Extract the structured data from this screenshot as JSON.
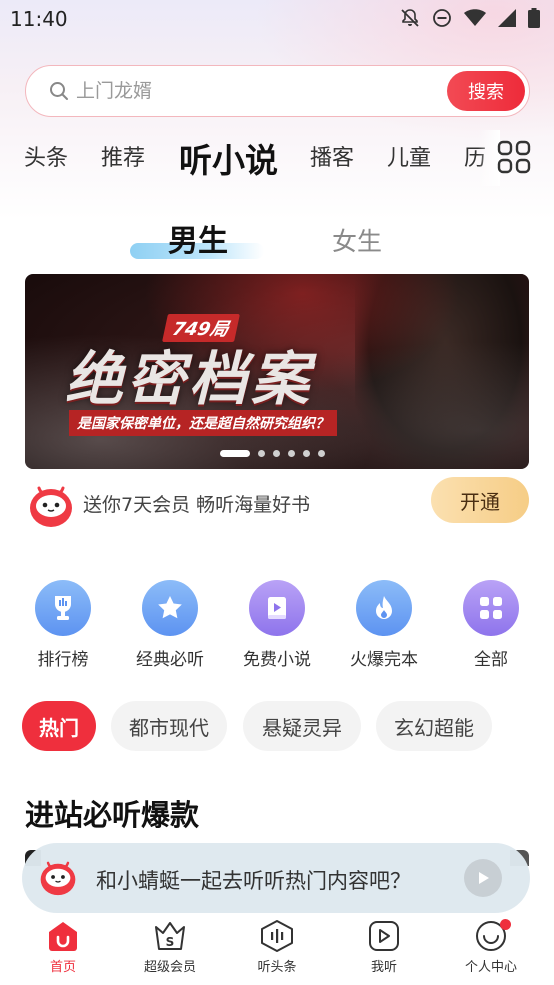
{
  "status_bar": {
    "time": "11:40",
    "icons": [
      "notifications-off-icon",
      "do-not-disturb-icon",
      "wifi-icon",
      "signal-icon",
      "battery-icon"
    ]
  },
  "search": {
    "placeholder": "上门龙婿",
    "button_label": "搜索"
  },
  "category_tabs": [
    {
      "label": "头条",
      "active": false
    },
    {
      "label": "推荐",
      "active": false
    },
    {
      "label": "听小说",
      "active": true
    },
    {
      "label": "播客",
      "active": false
    },
    {
      "label": "儿童",
      "active": false
    },
    {
      "label": "历",
      "active": false
    }
  ],
  "gender_tabs": {
    "male": "男生",
    "female": "女生",
    "selected": "男生"
  },
  "banner": {
    "tag": "749局",
    "title": "绝密档案",
    "subtitle": "是国家保密单位，还是超自然研究组织？",
    "slide_count": 6,
    "active_slide": 1
  },
  "vip_promo": {
    "text": "送你7天会员 畅听海量好书",
    "button_label": "开通"
  },
  "shortcuts": [
    {
      "label": "排行榜",
      "icon": "trophy-icon"
    },
    {
      "label": "经典必听",
      "icon": "star-icon"
    },
    {
      "label": "免费小说",
      "icon": "book-icon"
    },
    {
      "label": "火爆完本",
      "icon": "flame-icon"
    },
    {
      "label": "全部",
      "icon": "grid-icon"
    }
  ],
  "filter_chips": [
    {
      "label": "热门",
      "active": true
    },
    {
      "label": "都市现代",
      "active": false
    },
    {
      "label": "悬疑灵异",
      "active": false
    },
    {
      "label": "玄幻超能",
      "active": false
    }
  ],
  "section": {
    "title": "进站必听爆款"
  },
  "floating_prompt": {
    "text": "和小蜻蜓一起去听听热门内容吧？"
  },
  "bottom_nav": [
    {
      "label": "首页",
      "icon": "home-icon",
      "active": true
    },
    {
      "label": "超级会员",
      "icon": "vip-crown-icon",
      "active": false
    },
    {
      "label": "听头条",
      "icon": "audio-headline-icon",
      "active": false
    },
    {
      "label": "我听",
      "icon": "play-square-icon",
      "active": false
    },
    {
      "label": "个人中心",
      "icon": "profile-smile-icon",
      "active": false,
      "badge": true
    }
  ],
  "colors": {
    "accent_red": "#ef2f3d",
    "vip_gold": "#f6cd86",
    "shortcut_blue": "#4a7ef0"
  }
}
